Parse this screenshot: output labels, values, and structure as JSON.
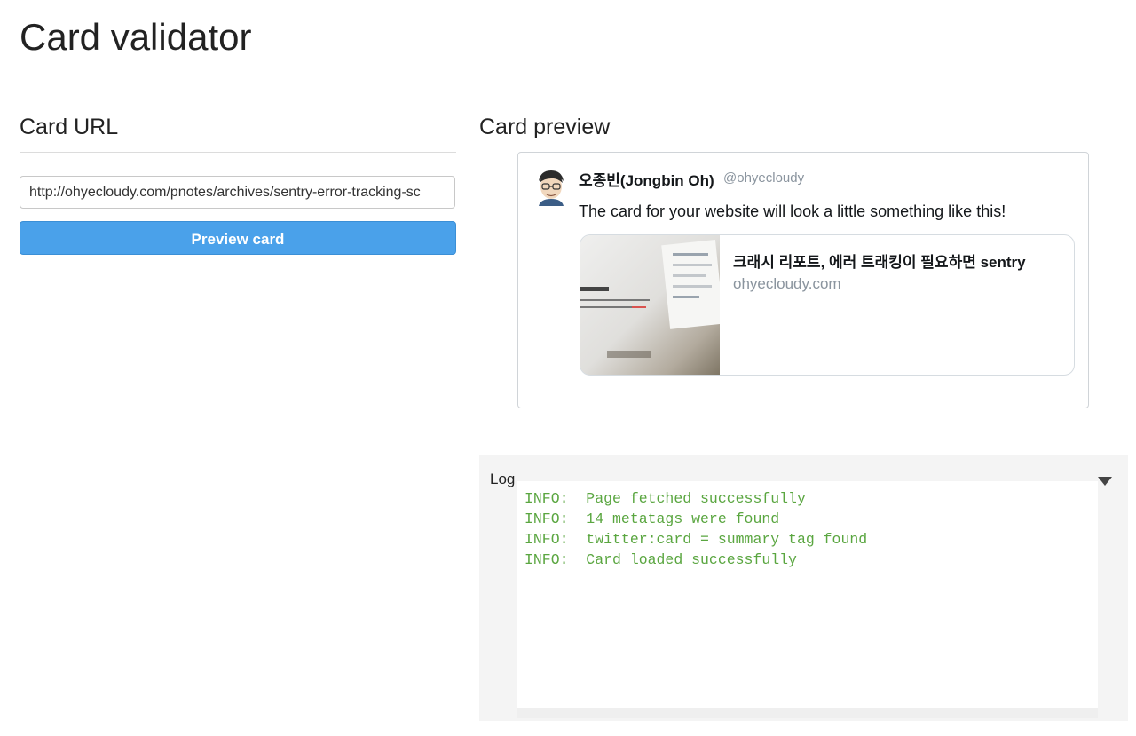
{
  "page": {
    "title": "Card validator"
  },
  "card_url": {
    "heading": "Card URL",
    "input_value": "http://ohyecloudy.com/pnotes/archives/sentry-error-tracking-sc",
    "button_label": "Preview card"
  },
  "card_preview": {
    "heading": "Card preview",
    "author_name": "오종빈(Jongbin Oh)",
    "author_handle": "@ohyecloudy",
    "tweet_text": "The card for your website will look a little something like this!",
    "card": {
      "title": "크래시 리포트, 에러 트래킹이 필요하면 sentry",
      "domain": "ohyecloudy.com"
    }
  },
  "log": {
    "label": "Log",
    "lines": [
      "INFO:  Page fetched successfully",
      "INFO:  14 metatags were found",
      "INFO:  twitter:card = summary tag found",
      "INFO:  Card loaded successfully"
    ]
  }
}
